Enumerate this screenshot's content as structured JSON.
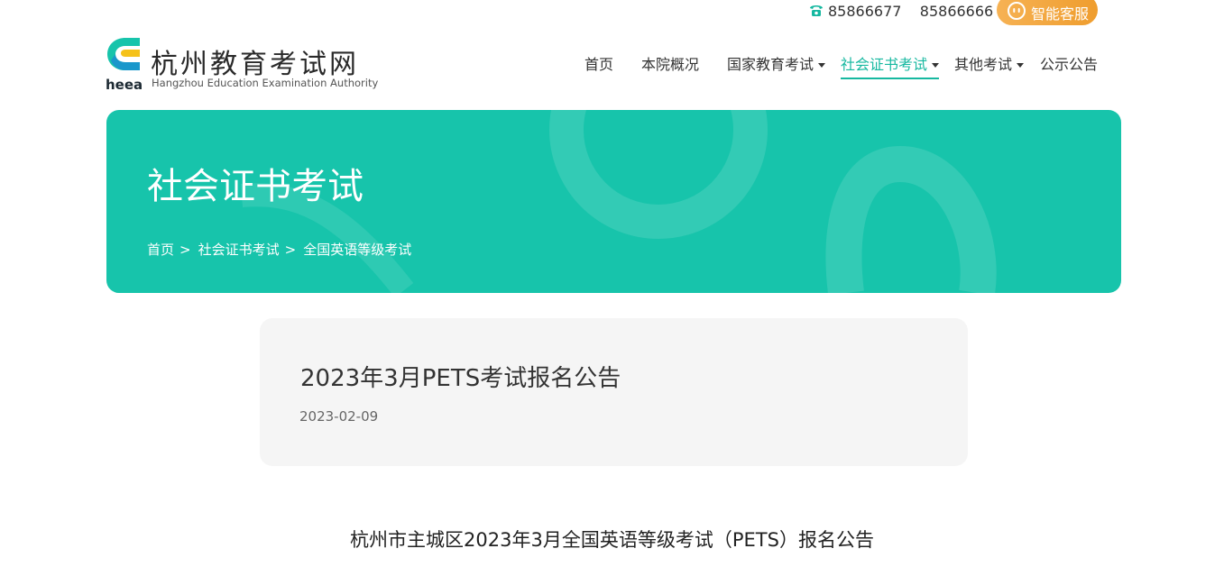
{
  "topbar": {
    "phones": "85866677    85866666",
    "service_label": "智能客服"
  },
  "logo": {
    "abbr": "heea",
    "name_cn": "杭州教育考试网",
    "name_en": "Hangzhou Education Examination Authority"
  },
  "nav": {
    "items": [
      {
        "label": "首页"
      },
      {
        "label": "本院概况"
      },
      {
        "label": "国家教育考试"
      },
      {
        "label": "社会证书考试"
      },
      {
        "label": "其他考试"
      },
      {
        "label": "公示公告"
      }
    ]
  },
  "banner": {
    "title": "社会证书考试",
    "breadcrumb": [
      "首页",
      "社会证书考试",
      "全国英语等级考试"
    ],
    "separator": ">"
  },
  "article": {
    "title": "2023年3月PETS考试报名公告",
    "date": "2023-02-09",
    "subheading": "杭州市主城区2023年3月全国英语等级考试（PETS）报名公告"
  },
  "colors": {
    "accent": "#16b8a0",
    "banner": "#17c4ab",
    "service_button": "#f0a23a"
  }
}
